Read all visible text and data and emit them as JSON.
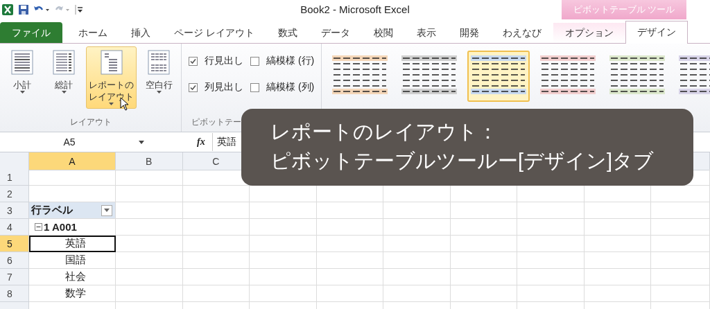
{
  "window": {
    "title": "Book2 - Microsoft Excel",
    "context_tab_group": "ピボットテーブル ツール"
  },
  "tabs": [
    {
      "label": "ファイル",
      "kind": "file",
      "selected": false
    },
    {
      "label": "ホーム",
      "kind": "normal",
      "selected": false
    },
    {
      "label": "挿入",
      "kind": "normal",
      "selected": false
    },
    {
      "label": "ページ レイアウト",
      "kind": "normal",
      "selected": false
    },
    {
      "label": "数式",
      "kind": "normal",
      "selected": false
    },
    {
      "label": "データ",
      "kind": "normal",
      "selected": false
    },
    {
      "label": "校閲",
      "kind": "normal",
      "selected": false
    },
    {
      "label": "表示",
      "kind": "normal",
      "selected": false
    },
    {
      "label": "開発",
      "kind": "normal",
      "selected": false
    },
    {
      "label": "わえなび",
      "kind": "normal",
      "selected": false
    },
    {
      "label": "オプション",
      "kind": "context",
      "selected": false
    },
    {
      "label": "デザイン",
      "kind": "context",
      "selected": true
    }
  ],
  "ribbon": {
    "layout_group": {
      "label": "レイアウト",
      "buttons": [
        {
          "lines": [
            "小計"
          ],
          "kind": "subtotal",
          "hovered": false
        },
        {
          "lines": [
            "総計"
          ],
          "kind": "grandtotal",
          "hovered": false
        },
        {
          "lines": [
            "レポートの",
            "レイアウト"
          ],
          "kind": "report",
          "hovered": true
        },
        {
          "lines": [
            "空白行"
          ],
          "kind": "blank",
          "hovered": false
        }
      ]
    },
    "options_group": {
      "label": "ピボットテー",
      "checkboxes": [
        {
          "label": "行見出し",
          "checked": true
        },
        {
          "label": "縞模様 (行)",
          "checked": false
        },
        {
          "label": "列見出し",
          "checked": true
        },
        {
          "label": "縞模様 (列)",
          "checked": false
        }
      ]
    },
    "styles_group": {
      "styles": [
        {
          "color": "#f4d6b8",
          "selected": false
        },
        {
          "color": "#cfcfcf",
          "selected": false
        },
        {
          "color": "#c9daf0",
          "selected": true
        },
        {
          "color": "#f2cfcf",
          "selected": false
        },
        {
          "color": "#dce8cc",
          "selected": false
        },
        {
          "color": "#d8d4e8",
          "selected": false
        }
      ]
    }
  },
  "formula_bar": {
    "name_box": "A5",
    "function_label": "fx",
    "value": "英語"
  },
  "sheet": {
    "columns": [
      {
        "label": "A",
        "selected": true
      },
      {
        "label": "B",
        "selected": false
      },
      {
        "label": "C",
        "selected": false
      }
    ],
    "rows": [
      {
        "header": "1",
        "kind": "empty",
        "selected": false
      },
      {
        "header": "2",
        "kind": "empty",
        "selected": false
      },
      {
        "header": "3",
        "kind": "label-header",
        "label": "行ラベル",
        "selected": false
      },
      {
        "header": "4",
        "kind": "group",
        "label": "1 A001",
        "expanded": true,
        "selected": false
      },
      {
        "header": "5",
        "kind": "item",
        "label": "英語",
        "selected": true
      },
      {
        "header": "6",
        "kind": "item",
        "label": "国語",
        "selected": false
      },
      {
        "header": "7",
        "kind": "item",
        "label": "社会",
        "selected": false
      },
      {
        "header": "8",
        "kind": "item",
        "label": "数学",
        "selected": false
      }
    ]
  },
  "caption": {
    "lines": [
      "レポートのレイアウト：",
      "ピボットテーブルツールー[デザイン]タブ"
    ]
  }
}
